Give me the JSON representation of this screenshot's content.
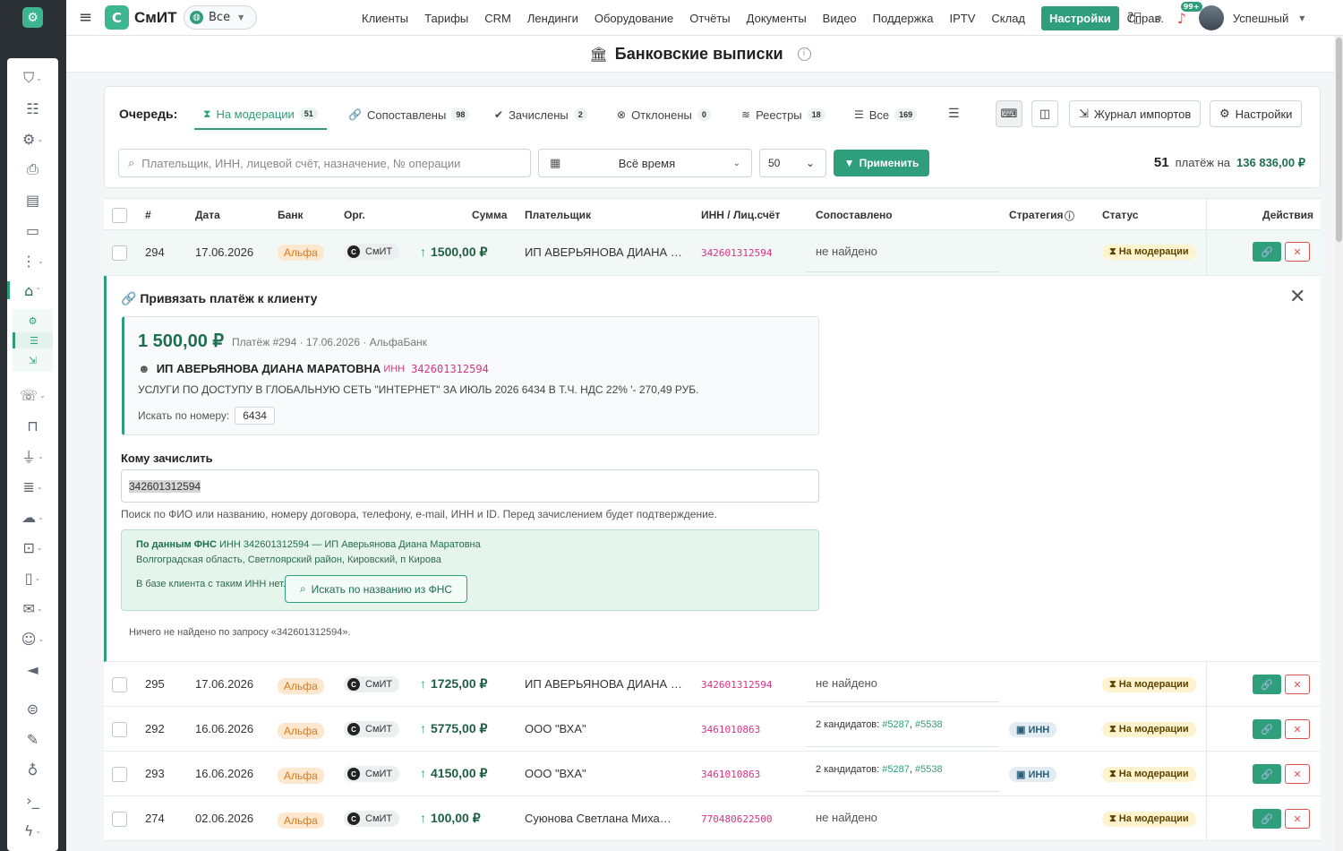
{
  "app": {
    "brand": "СмИТ",
    "scope": "Все",
    "nav": [
      "Клиенты",
      "Тарифы",
      "CRM",
      "Лендинги",
      "Оборудование",
      "Отчёты",
      "Документы",
      "Видео",
      "Поддержка",
      "IPTV",
      "Склад"
    ],
    "nav_active": "Настройки",
    "nav_help": "Справ.",
    "notifications": "99+",
    "user": "Успешный"
  },
  "page": {
    "title": "Банковские выписки"
  },
  "queue": {
    "label": "Очередь:",
    "tabs": [
      {
        "label": "На модерации",
        "count": "51",
        "icon": "hourglass-icon"
      },
      {
        "label": "Сопоставлены",
        "count": "98",
        "icon": "link-icon"
      },
      {
        "label": "Зачислены",
        "count": "2",
        "icon": "check-circle-icon"
      },
      {
        "label": "Отклонены",
        "count": "0",
        "icon": "x-circle-icon"
      },
      {
        "label": "Реестры",
        "count": "18",
        "icon": "layers-icon"
      },
      {
        "label": "Все",
        "count": "169",
        "icon": "list-icon"
      }
    ],
    "import_log": "Журнал импортов",
    "settings": "Настройки"
  },
  "filters": {
    "search_placeholder": "Плательщик, ИНН, лицевой счёт, назначение, № операции",
    "period": "Всё время",
    "per_page": "50",
    "apply": "Применить",
    "total_count": "51",
    "total_mid": "платёж на",
    "total_sum": "136 836,00 ₽"
  },
  "table": {
    "headers": {
      "num": "#",
      "date": "Дата",
      "bank": "Банк",
      "org": "Орг.",
      "sum": "Сумма",
      "payer": "Плательщик",
      "inn": "ИНН / Лиц.счёт",
      "match": "Сопоставлено",
      "strategy": "Стратегия",
      "status": "Статус",
      "actions": "Действия"
    },
    "rows": [
      {
        "id": "294",
        "date": "17.06.2026",
        "bank": "Альфа",
        "org": "СмИТ",
        "sum": "1500,00 ₽",
        "payer": "ИП АВЕРЬЯНОВА ДИАНА …",
        "inn": "342601312594",
        "match_text": "не найдено",
        "strategy": "",
        "status": "На модерации"
      },
      {
        "id": "295",
        "date": "17.06.2026",
        "bank": "Альфа",
        "org": "СмИТ",
        "sum": "1725,00 ₽",
        "payer": "ИП АВЕРЬЯНОВА ДИАНА …",
        "inn": "342601312594",
        "match_text": "не найдено",
        "strategy": "",
        "status": "На модерации"
      },
      {
        "id": "292",
        "date": "16.06.2026",
        "bank": "Альфа",
        "org": "СмИТ",
        "sum": "5775,00 ₽",
        "payer": "ООО \"ВХА\"",
        "inn": "3461010863",
        "match_text": "2 кандидатов:",
        "match_links": [
          "#5287",
          "#5538"
        ],
        "strategy": "ИНН",
        "status": "На модерации"
      },
      {
        "id": "293",
        "date": "16.06.2026",
        "bank": "Альфа",
        "org": "СмИТ",
        "sum": "4150,00 ₽",
        "payer": "ООО \"ВХА\"",
        "inn": "3461010863",
        "match_text": "2 кандидатов:",
        "match_links": [
          "#5287",
          "#5538"
        ],
        "strategy": "ИНН",
        "status": "На модерации"
      },
      {
        "id": "274",
        "date": "02.06.2026",
        "bank": "Альфа",
        "org": "СмИТ",
        "sum": "100,00 ₽",
        "payer": "Суюнова Светлана Миха…",
        "inn": "770480622500",
        "match_text": "не найдено",
        "strategy": "",
        "status": "На модерации"
      }
    ]
  },
  "bind_panel": {
    "title": "Привязать платёж к клиенту",
    "amount": "1 500,00 ₽",
    "meta": "Платёж #294 · 17.06.2026 · АльфаБанк",
    "payer": "ИП АВЕРЬЯНОВА ДИАНА МАРАТОВНА",
    "inn_label": "ИНН",
    "inn": "342601312594",
    "purpose": "УСЛУГИ ПО ДОСТУПУ В ГЛОБАЛЬНУЮ СЕТЬ \"ИНТЕРНЕТ\" ЗА ИЮЛЬ 2026 6434 В Т.Ч. НДС 22% '- 270,49 РУБ.",
    "search_by_number_label": "Искать по номеру:",
    "search_number": "6434",
    "whom_label": "Кому зачислить",
    "whom_value": "342601312594",
    "whom_hint": "Поиск по ФИО или названию, номеру договора, телефону, e-mail, ИНН и ID. Перед зачислением будет подтверждение.",
    "fns_title": "По данным ФНС",
    "fns_info": "ИНН 342601312594 — ИП Аверьянова Диана Маратовна",
    "fns_address": "Волгоградская область, Светлоярский район, Кировский, п Кирова",
    "fns_no_client": "В базе клиента с таким ИНН нет.",
    "fns_button": "Искать по названию из ФНС",
    "not_found": "Ничего не найдено по запросу «342601312594»."
  }
}
